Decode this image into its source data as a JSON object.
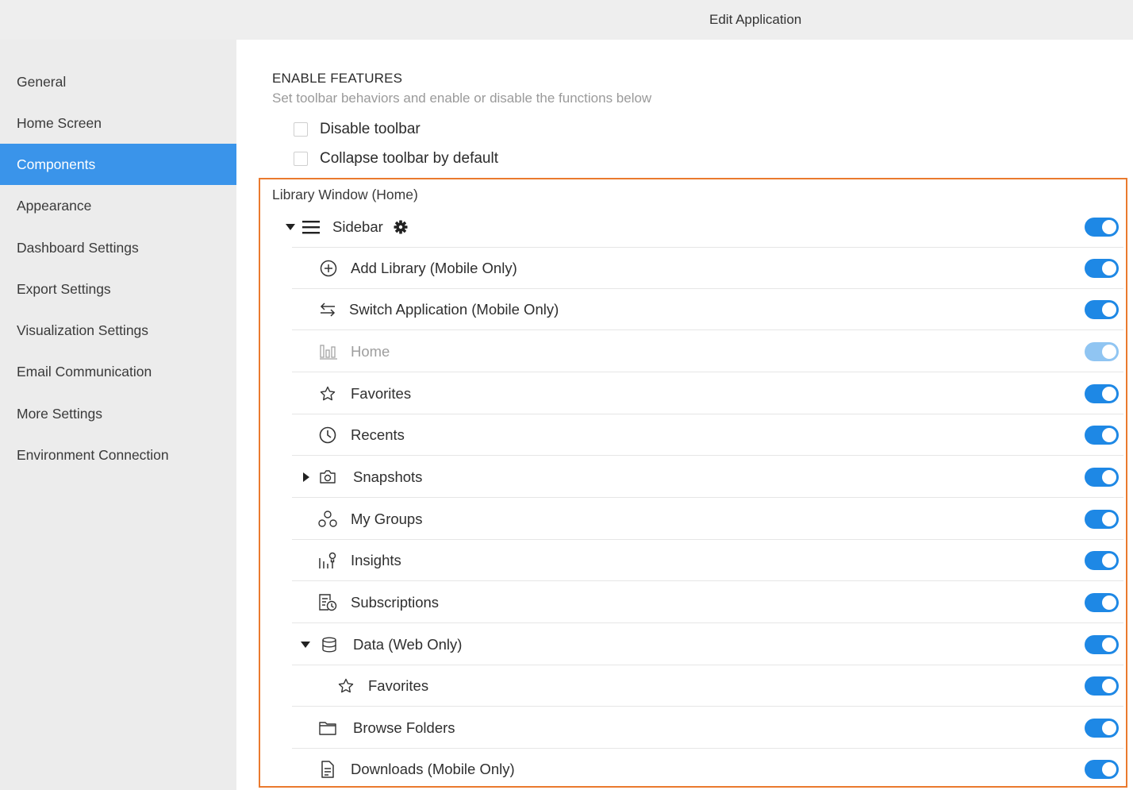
{
  "window": {
    "title": "Edit Application"
  },
  "nav": {
    "items": [
      {
        "label": "General",
        "icon": "",
        "active": false
      },
      {
        "label": "Home Screen",
        "active": false
      },
      {
        "label": "Components",
        "active": true
      },
      {
        "label": "Appearance",
        "active": false
      },
      {
        "label": "Dashboard Settings",
        "active": false
      },
      {
        "label": "Export Settings",
        "active": false
      },
      {
        "label": "Visualization Settings",
        "active": false
      },
      {
        "label": "Email Communication",
        "active": false
      },
      {
        "label": "More Settings",
        "active": false
      },
      {
        "label": "Environment Connection",
        "active": false
      }
    ]
  },
  "features": {
    "title": "ENABLE FEATURES",
    "description": "Set toolbar behaviors and enable or disable the functions below",
    "checkboxes": [
      {
        "label": "Disable toolbar",
        "checked": false
      },
      {
        "label": "Collapse toolbar by default",
        "checked": false
      }
    ]
  },
  "library": {
    "title": "Library Window (Home)",
    "sidebar_label": "Sidebar",
    "items": [
      {
        "label": "Sidebar",
        "icon": "menu-icon",
        "on": true
      },
      {
        "label": "Add Library (Mobile Only)",
        "icon": "add-circle-icon",
        "on": true
      },
      {
        "label": "Switch Application (Mobile Only)",
        "icon": "switch-arrows-icon",
        "on": true
      },
      {
        "label": "Home",
        "icon": "home-chart-icon",
        "on": true,
        "disabled": true
      },
      {
        "label": "Favorites",
        "icon": "star-icon",
        "on": true
      },
      {
        "label": "Recents",
        "icon": "clock-icon",
        "on": true
      },
      {
        "label": "Snapshots",
        "icon": "camera-icon",
        "on": true
      },
      {
        "label": "My Groups",
        "icon": "groups-icon",
        "on": true
      },
      {
        "label": "Insights",
        "icon": "insights-icon",
        "on": true
      },
      {
        "label": "Subscriptions",
        "icon": "subscriptions-icon",
        "on": true
      },
      {
        "label": "Data (Web Only)",
        "icon": "database-icon",
        "on": true
      },
      {
        "label": "Favorites",
        "icon": "star-icon",
        "on": true
      },
      {
        "label": "Browse Folders",
        "icon": "folder-icon",
        "on": true
      },
      {
        "label": "Downloads (Mobile Only)",
        "icon": "document-icon",
        "on": true
      }
    ]
  },
  "colors": {
    "accent": "#1e88e5",
    "nav_active": "#3a94ea",
    "frame": "#ea7a2e"
  }
}
